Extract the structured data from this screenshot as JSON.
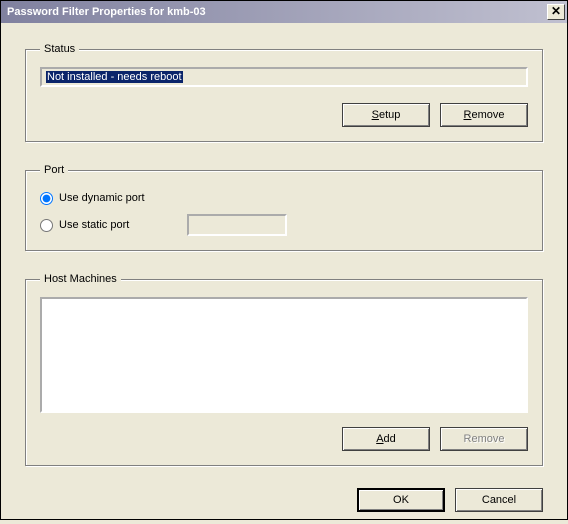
{
  "window": {
    "title": "Password Filter Properties for kmb-03"
  },
  "status": {
    "legend": "Status",
    "text": "Not installed - needs reboot",
    "setup_label": "Setup",
    "setup_ul": "S",
    "setup_rest": "etup",
    "remove_label": "Remove",
    "remove_ul": "R",
    "remove_rest": "emove"
  },
  "port": {
    "legend": "Port",
    "dynamic_label": "Use dynamic port",
    "static_label": "Use static port",
    "static_value": ""
  },
  "hosts": {
    "legend": "Host Machines",
    "add_ul": "A",
    "add_rest": "dd",
    "remove_ul": "R",
    "remove_rest": "emo",
    "remove_ul2": "v",
    "remove_rest2": "e"
  },
  "dialog": {
    "ok_label": "OK",
    "cancel_label": "Cancel"
  }
}
